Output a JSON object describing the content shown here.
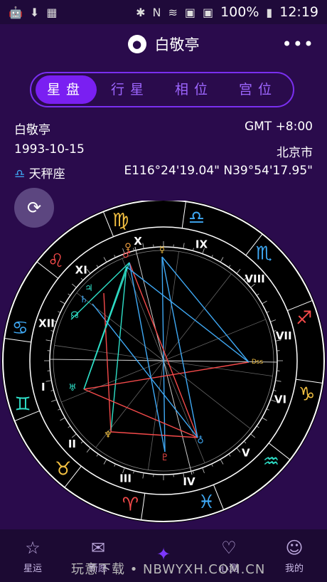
{
  "status": {
    "battery": "100%",
    "time": "12:19",
    "left_icons": [
      "android-icon",
      "download-icon",
      "calendar-icon"
    ],
    "right_icons": [
      "bluetooth-icon",
      "nfc-icon",
      "wifi-icon",
      "sim1-icon",
      "sim2-icon",
      "battery-icon"
    ]
  },
  "header": {
    "title": "白敬亭",
    "more_label": "•••"
  },
  "tabs": [
    {
      "label": "星盘",
      "active": true
    },
    {
      "label": "行星",
      "active": false
    },
    {
      "label": "相位",
      "active": false
    },
    {
      "label": "宫位",
      "active": false
    }
  ],
  "info": {
    "name": "白敬亭",
    "timezone": "GMT +8:00",
    "date": "1993-10-15",
    "city": "北京市",
    "sign_symbol": "♎",
    "sign": "天秤座",
    "coords": "E116°24'19.04\"  N39°54'17.95\""
  },
  "chart": {
    "outer_signs": [
      "♎",
      "♍",
      "♌",
      "♋",
      "♊",
      "♉",
      "♈",
      "♓",
      "♒",
      "♑",
      "♐",
      "♏"
    ],
    "sign_colors": [
      "#3fa9f5",
      "#f5c242",
      "#f54a4a",
      "#3fa9f5",
      "#2ee0c8",
      "#f5c242",
      "#f54a4a",
      "#3fa9f5",
      "#2ee0c8",
      "#f5c242",
      "#f54a4a",
      "#3fa9f5"
    ],
    "house_numbers": [
      "IX",
      "VIII",
      "VII",
      "VI",
      "V",
      "IV",
      "III",
      "II",
      "I",
      "XII",
      "XI",
      "X"
    ],
    "center_label": "Dss"
  },
  "nav": [
    {
      "label": "星运",
      "icon": "☆",
      "active": false
    },
    {
      "label": "新愿",
      "icon": "✉",
      "active": false
    },
    {
      "label": "",
      "icon": "✦",
      "active": true
    },
    {
      "label": "心测",
      "icon": "♡",
      "active": false
    },
    {
      "label": "我的",
      "icon": "☺",
      "active": false
    }
  ],
  "watermark": "玩意下载 • NBWYXH.COM.CN"
}
